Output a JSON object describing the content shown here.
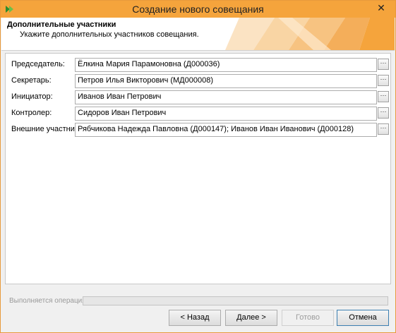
{
  "window": {
    "title": "Создание нового совещания",
    "close_glyph": "✕",
    "accent_color": "#f5a43c"
  },
  "header": {
    "title": "Дополнительные участники",
    "subtitle": "Укажите дополнительных участников совещания."
  },
  "fields": [
    {
      "label": "Председатель:",
      "value": "Ёлкина Мария Парамоновна (Д000036)"
    },
    {
      "label": "Секретарь:",
      "value": "Петров Илья Викторович (МД000008)"
    },
    {
      "label": "Инициатор:",
      "value": "Иванов Иван Петрович"
    },
    {
      "label": "Контролер:",
      "value": "Сидоров Иван Петрович"
    },
    {
      "label": "Внешние участники:",
      "value": "Рябчикова Надежда Павловна (Д000147); Иванов Иван Иванович (Д000128)"
    }
  ],
  "select_button_glyph": "···",
  "status": {
    "label": "Выполняется операция",
    "progress": 0
  },
  "buttons": {
    "back": "< Назад",
    "next": "Далее >",
    "finish": "Готово",
    "cancel": "Отмена"
  }
}
